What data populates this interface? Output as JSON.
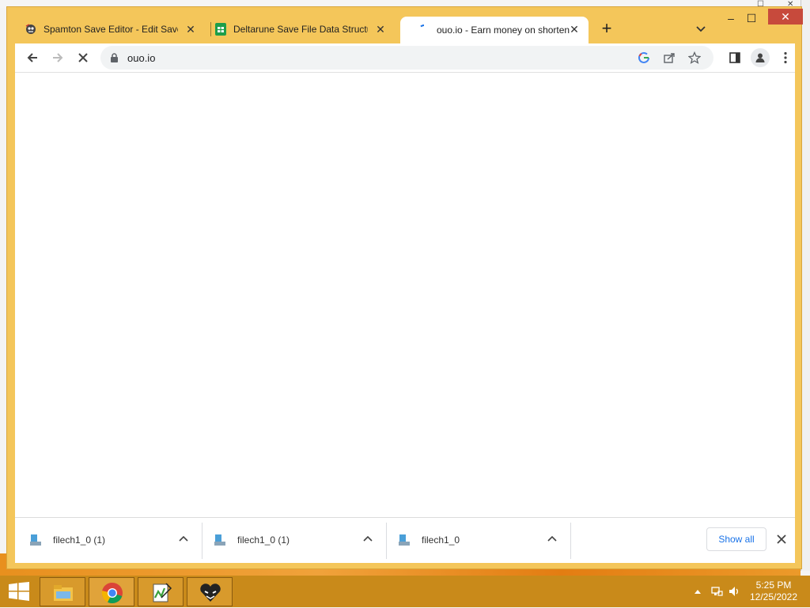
{
  "browser": {
    "tabs": [
      {
        "title": "Spamton Save Editor - Edit Save",
        "favicon": "spamton-face-icon",
        "active": false
      },
      {
        "title": "Deltarune Save File Data Structur",
        "favicon": "google-sheets-icon",
        "active": false
      },
      {
        "title": "ouo.io - Earn money on shorten",
        "favicon": "loading-icon",
        "active": true
      }
    ],
    "new_tab_label": "+",
    "address": "ouo.io",
    "window_controls": {
      "minimize": "–",
      "maximize": "☐",
      "close": "✕"
    }
  },
  "downloads": {
    "items": [
      {
        "name": "filech1_0 (1)"
      },
      {
        "name": "filech1_0 (1)"
      },
      {
        "name": "filech1_0"
      }
    ],
    "show_all_label": "Show all"
  },
  "taskbar": {
    "apps": [
      "file-explorer-icon",
      "chrome-icon",
      "notepad-plus-icon",
      "heart-face-icon"
    ],
    "time": "5:25 PM",
    "date": "12/25/2022"
  },
  "colors": {
    "window_frame": "#f4c65a",
    "taskbar": "#c98a1a",
    "close_button": "#c74a3c",
    "link_blue": "#1a73e8"
  }
}
